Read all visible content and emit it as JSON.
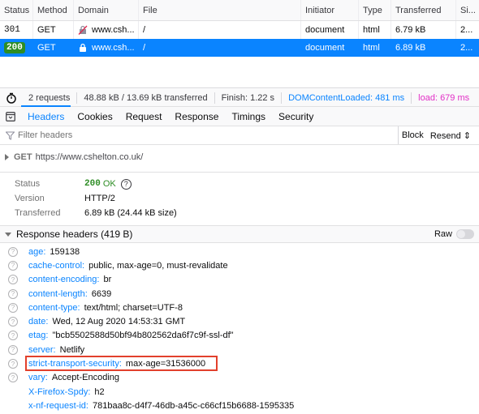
{
  "request_table": {
    "columns": [
      "Status",
      "Method",
      "Domain",
      "File",
      "Initiator",
      "Type",
      "Transferred",
      "Si..."
    ],
    "rows": [
      {
        "status": "301",
        "method": "GET",
        "domain": "www.csh...",
        "domain_icon": "insecure-lock-icon",
        "file": "/",
        "initiator": "document",
        "type": "html",
        "transferred": "6.79 kB",
        "size": "2...",
        "selected": false
      },
      {
        "status": "200",
        "method": "GET",
        "domain": "www.csh...",
        "domain_icon": "lock-icon",
        "file": "/",
        "initiator": "document",
        "type": "html",
        "transferred": "6.89 kB",
        "size": "2...",
        "selected": true
      }
    ]
  },
  "status_bar": {
    "icon": "stopwatch-icon",
    "requests": "2 requests",
    "transferred": "48.88 kB / 13.69 kB transferred",
    "finish": "Finish: 1.22 s",
    "dom_content_loaded": "DOMContentLoaded: 481 ms",
    "load": "load: 679 ms"
  },
  "tabs": {
    "items": [
      "Headers",
      "Cookies",
      "Request",
      "Response",
      "Timings",
      "Security"
    ],
    "active": "Headers"
  },
  "filter": {
    "placeholder": "Filter headers",
    "block_label": "Block",
    "resend_label": "Resend ⇕"
  },
  "summary": {
    "method": "GET",
    "url": "https://www.cshelton.co.uk/",
    "status_label": "Status",
    "status_code": "200",
    "status_text": "OK",
    "version_label": "Version",
    "version": "HTTP/2",
    "transferred_label": "Transferred",
    "transferred": "6.89 kB (24.44 kB size)"
  },
  "response_headers": {
    "title": "Response headers (419 B)",
    "raw_label": "Raw",
    "raw_enabled": false,
    "items": [
      {
        "name": "age:",
        "value": "159138",
        "help": true
      },
      {
        "name": "cache-control:",
        "value": "public, max-age=0, must-revalidate",
        "help": true
      },
      {
        "name": "content-encoding:",
        "value": "br",
        "help": true
      },
      {
        "name": "content-length:",
        "value": "6639",
        "help": true
      },
      {
        "name": "content-type:",
        "value": "text/html; charset=UTF-8",
        "help": true
      },
      {
        "name": "date:",
        "value": "Wed, 12 Aug 2020 14:53:31 GMT",
        "help": true
      },
      {
        "name": "etag:",
        "value": "\"bcb5502588d50bf94b802562da6f7c9f-ssl-df\"",
        "help": true
      },
      {
        "name": "server:",
        "value": "Netlify",
        "help": true
      },
      {
        "name": "strict-transport-security:",
        "value": "max-age=31536000",
        "help": true,
        "highlighted": true
      },
      {
        "name": "vary:",
        "value": "Accept-Encoding",
        "help": true
      },
      {
        "name": "X-Firefox-Spdy:",
        "value": "h2",
        "help": false
      },
      {
        "name": "x-nf-request-id:",
        "value": "781baa8c-d4f7-46db-a45c-c66cf15b6688-1595335",
        "help": false
      }
    ]
  },
  "colors": {
    "accent": "#0a84ff",
    "status_ok": "#2e8d25",
    "load": "#e22ec6",
    "highlight_box": "#e2402c"
  }
}
